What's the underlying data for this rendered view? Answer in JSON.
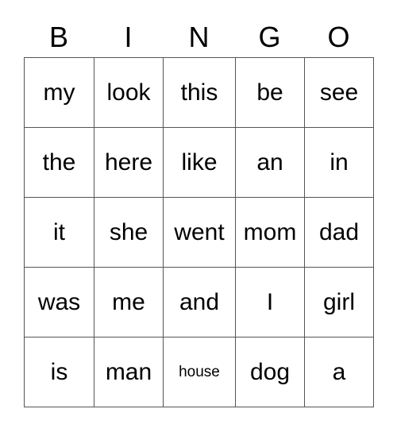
{
  "card": {
    "title_letters": [
      "B",
      "I",
      "N",
      "G",
      "O"
    ],
    "columns": 5,
    "rows": 5,
    "border_color": "#555555",
    "background_color": "#ffffff",
    "text_color": "#000000",
    "cells": [
      [
        {
          "text": "my",
          "size": "normal"
        },
        {
          "text": "look",
          "size": "normal"
        },
        {
          "text": "this",
          "size": "normal"
        },
        {
          "text": "be",
          "size": "normal"
        },
        {
          "text": "see",
          "size": "normal"
        }
      ],
      [
        {
          "text": "the",
          "size": "normal"
        },
        {
          "text": "here",
          "size": "normal"
        },
        {
          "text": "like",
          "size": "normal"
        },
        {
          "text": "an",
          "size": "normal"
        },
        {
          "text": "in",
          "size": "normal"
        }
      ],
      [
        {
          "text": "it",
          "size": "normal"
        },
        {
          "text": "she",
          "size": "normal"
        },
        {
          "text": "went",
          "size": "normal"
        },
        {
          "text": "mom",
          "size": "normal"
        },
        {
          "text": "dad",
          "size": "normal"
        }
      ],
      [
        {
          "text": "was",
          "size": "normal"
        },
        {
          "text": "me",
          "size": "normal"
        },
        {
          "text": "and",
          "size": "normal"
        },
        {
          "text": "I",
          "size": "normal"
        },
        {
          "text": "girl",
          "size": "normal"
        }
      ],
      [
        {
          "text": "is",
          "size": "normal"
        },
        {
          "text": "man",
          "size": "normal"
        },
        {
          "text": "house",
          "size": "small"
        },
        {
          "text": "dog",
          "size": "normal"
        },
        {
          "text": "a",
          "size": "normal"
        }
      ]
    ]
  }
}
